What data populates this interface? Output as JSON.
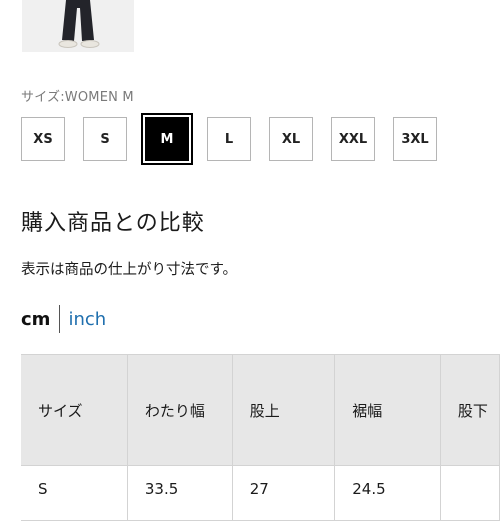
{
  "product_image": {
    "alt": ""
  },
  "size_selector": {
    "caption": "サイズ:WOMEN M",
    "options": [
      "XS",
      "S",
      "M",
      "L",
      "XL",
      "XXL",
      "3XL"
    ],
    "selected": "M"
  },
  "comparison": {
    "title": "購入商品との比較",
    "note": "表示は商品の仕上がり寸法です。"
  },
  "units": {
    "cm": "cm",
    "inch": "inch",
    "active": "cm"
  },
  "size_table": {
    "headers": [
      "サイズ",
      "わたり幅",
      "股上",
      "裾幅",
      "股下"
    ],
    "rows": [
      [
        "S",
        "33.5",
        "27",
        "24.5",
        ""
      ]
    ]
  },
  "colors": {
    "selected_bg": "#000000",
    "link_blue": "#1f6fae",
    "table_header_bg": "#e7e7e7"
  }
}
